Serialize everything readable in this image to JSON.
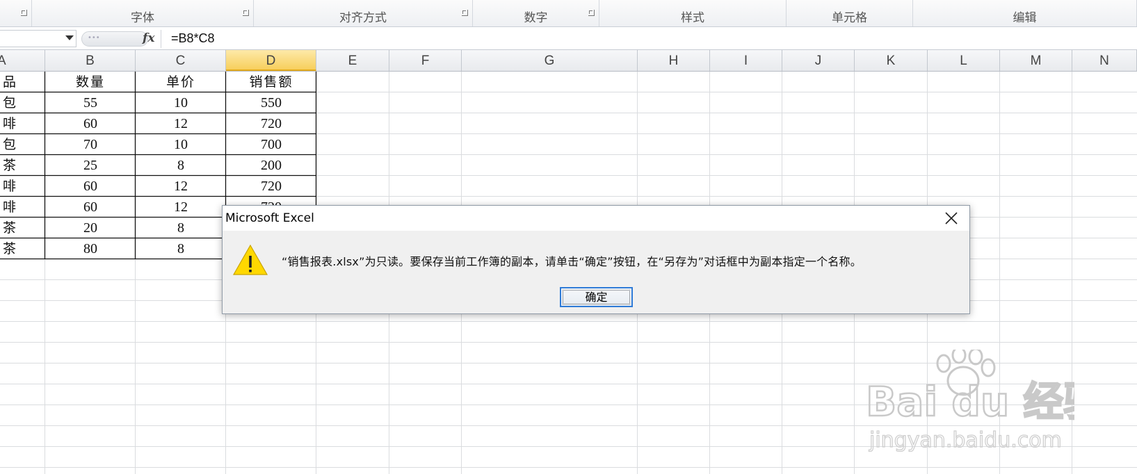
{
  "ribbon": {
    "groups": [
      {
        "label": "",
        "launcher": true
      },
      {
        "label": "字体",
        "launcher": true
      },
      {
        "label": "对齐方式",
        "launcher": true
      },
      {
        "label": "数字",
        "launcher": true
      },
      {
        "label": "样式",
        "launcher": false
      },
      {
        "label": "单元格",
        "launcher": false
      },
      {
        "label": "编辑",
        "launcher": false
      }
    ]
  },
  "formula_bar": {
    "name_box": "",
    "fx_label": "fx",
    "formula": "=B8*C8"
  },
  "sheet": {
    "columns": [
      "A",
      "B",
      "C",
      "D",
      "E",
      "F",
      "G",
      "H",
      "I",
      "J",
      "K",
      "L",
      "M",
      "N"
    ],
    "active_column": "D",
    "rows": [
      [
        "品",
        "数量",
        "单价",
        "销售额"
      ],
      [
        "包",
        "55",
        "10",
        "550"
      ],
      [
        "啡",
        "60",
        "12",
        "720"
      ],
      [
        "包",
        "70",
        "10",
        "700"
      ],
      [
        "茶",
        "25",
        "8",
        "200"
      ],
      [
        "啡",
        "60",
        "12",
        "720"
      ],
      [
        "啡",
        "60",
        "12",
        "720"
      ],
      [
        "茶",
        "20",
        "8",
        ""
      ],
      [
        "茶",
        "80",
        "8",
        ""
      ]
    ]
  },
  "dialog": {
    "title": "Microsoft Excel",
    "message": "“销售报表.xlsx”为只读。要保存当前工作簿的副本，请单击“确定”按钮，在“另存为”对话框中为副本指定一个名称。",
    "ok_label": "确定",
    "icon": "warning-icon",
    "close_icon": "close-icon"
  },
  "watermark": {
    "brand": "Bai du 经验",
    "url": "jingyan.baidu.com"
  }
}
